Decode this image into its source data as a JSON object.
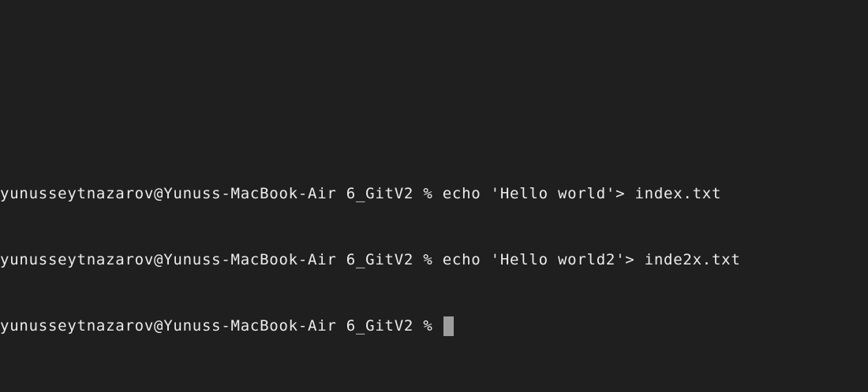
{
  "terminal": {
    "lines": [
      {
        "prompt": "yunusseytnazarov@Yunuss-MacBook-Air 6_GitV2 % ",
        "command": "echo 'Hello world'> index.txt"
      },
      {
        "prompt": "yunusseytnazarov@Yunuss-MacBook-Air 6_GitV2 % ",
        "command": "echo 'Hello world2'> inde2x.txt"
      },
      {
        "prompt": "yunusseytnazarov@Yunuss-MacBook-Air 6_GitV2 % ",
        "command": ""
      }
    ]
  },
  "colors": {
    "background": "#1f1f1f",
    "text": "#ececec",
    "cursor": "#9e9e9e"
  }
}
